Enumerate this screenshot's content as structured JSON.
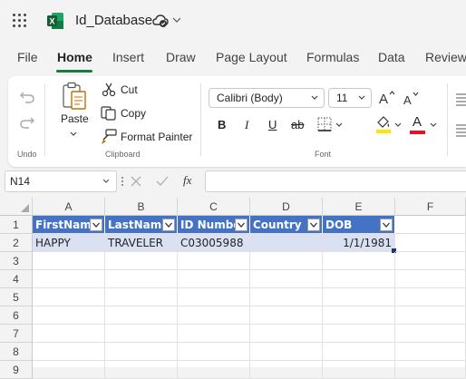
{
  "title_bar": {
    "app_icon": "excel-icon",
    "doc_title": "Id_Database"
  },
  "tabs": [
    "File",
    "Home",
    "Insert",
    "Draw",
    "Page Layout",
    "Formulas",
    "Data",
    "Review"
  ],
  "ribbon": {
    "undo_group": {
      "label": "Undo"
    },
    "clipboard": {
      "paste": "Paste",
      "cut": "Cut",
      "copy": "Copy",
      "format_painter": "Format Painter",
      "label": "Clipboard"
    },
    "font": {
      "family": "Calibri (Body)",
      "size": "11",
      "label": "Font",
      "bold": "B",
      "italic": "I",
      "underline": "U",
      "strike": "ab",
      "font_color_letter": "A",
      "highlight_color": "#ffe600",
      "font_color": "#e81123"
    }
  },
  "formula_bar": {
    "name_box": "N14",
    "fx": "fx",
    "formula": ""
  },
  "sheet": {
    "columns": [
      "A",
      "B",
      "C",
      "D",
      "E",
      "F"
    ],
    "rows": [
      "1",
      "2",
      "3",
      "4",
      "5",
      "6",
      "7",
      "8",
      "9"
    ],
    "table_headers": [
      "FirstName",
      "LastName",
      "ID Number",
      "Country",
      "DOB"
    ],
    "row2": [
      "HAPPY",
      "TRAVELER",
      "C03005988",
      "",
      "1/1/1981"
    ]
  }
}
